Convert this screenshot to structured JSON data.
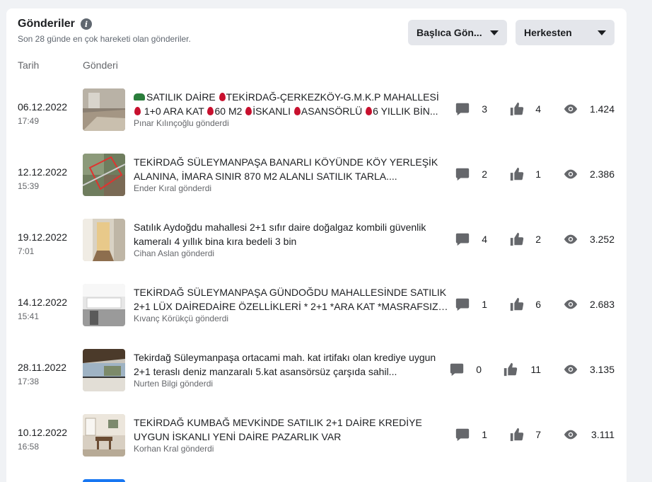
{
  "header": {
    "title": "Gönderiler",
    "subtitle": "Son 28 günde en çok hareketi olan gönderiler.",
    "sort_dropdown": "Başlıca Gön...",
    "audience_dropdown": "Herkesten"
  },
  "columns": {
    "date": "Tarih",
    "post": "Gönderi"
  },
  "posts": [
    {
      "date": "06.12.2022",
      "time": "17:49",
      "text_parts": [
        "SATILIK DAİRE ",
        "TEKİRDAĞ-ÇERKEZKÖY-G.M.K.P MAHALLESİ ",
        "1+0 ARA KAT ",
        "60 M2 ",
        "İSKANLI ",
        "ASANSÖRLÜ ",
        "6 YILLIK BİN..."
      ],
      "author": "Pınar Kılınçoğlu gönderdi",
      "comments": "3",
      "likes": "4",
      "views": "1.424"
    },
    {
      "date": "12.12.2022",
      "time": "15:39",
      "text": "TEKİRDAĞ SÜLEYMANPAŞA BANARLI KÖYÜNDE KÖY YERLEŞİK ALANINA, İMARA SINIR 870 M2 ALANLI SATILIK TARLA....",
      "author": "Ender Kıral gönderdi",
      "comments": "2",
      "likes": "1",
      "views": "2.386"
    },
    {
      "date": "19.12.2022",
      "time": "7:01",
      "text": "Satılık Aydoğdu mahallesi 2+1 sıfır daire doğalgaz kombili güvenlik kameralı 4 yıllık bina kıra bedeli 3 bin",
      "author": "Cihan Aslan gönderdi",
      "comments": "4",
      "likes": "2",
      "views": "3.252"
    },
    {
      "date": "14.12.2022",
      "time": "15:41",
      "text": "TEKİRDAĞ SÜLEYMANPAŞA GÜNDOĞDU MAHALLESİNDE SATILIK 2+1 LÜX DAİREDAİRE ÖZELLİKLERİ * 2+1 *ARA KAT *MASRAFSIZ ...",
      "author": "Kıvanç Körükçü gönderdi",
      "comments": "1",
      "likes": "6",
      "views": "2.683"
    },
    {
      "date": "28.11.2022",
      "time": "17:38",
      "text": "Tekirdağ Süleymanpaşa ortacami mah. kat irtifakı olan krediye uygun 2+1 teraslı deniz manzaralı 5.kat asansörsüz çarşıda sahil...",
      "author": "Nurten Bilgi gönderdi",
      "comments": "0",
      "likes": "11",
      "views": "3.135"
    },
    {
      "date": "10.12.2022",
      "time": "16:58",
      "text": "TEKİRDAĞ KUMBAĞ MEVKİNDE SATILIK 2+1 DAİRE KREDİYE UYGUN İSKANLI YENİ DAİRE PAZARLIK VAR",
      "author": "Korhan Kral gönderdi",
      "comments": "1",
      "likes": "7",
      "views": "3.111"
    }
  ],
  "icons": {
    "comment": "comment-icon",
    "like": "like-icon",
    "view": "eye-icon",
    "info": "info-icon"
  },
  "colors": {
    "card_bg": "#ffffff",
    "page_bg": "#f0f2f5",
    "dropdown_bg": "#e4e6eb",
    "icon_gray": "#65676b",
    "drop_red": "#c8102e"
  }
}
